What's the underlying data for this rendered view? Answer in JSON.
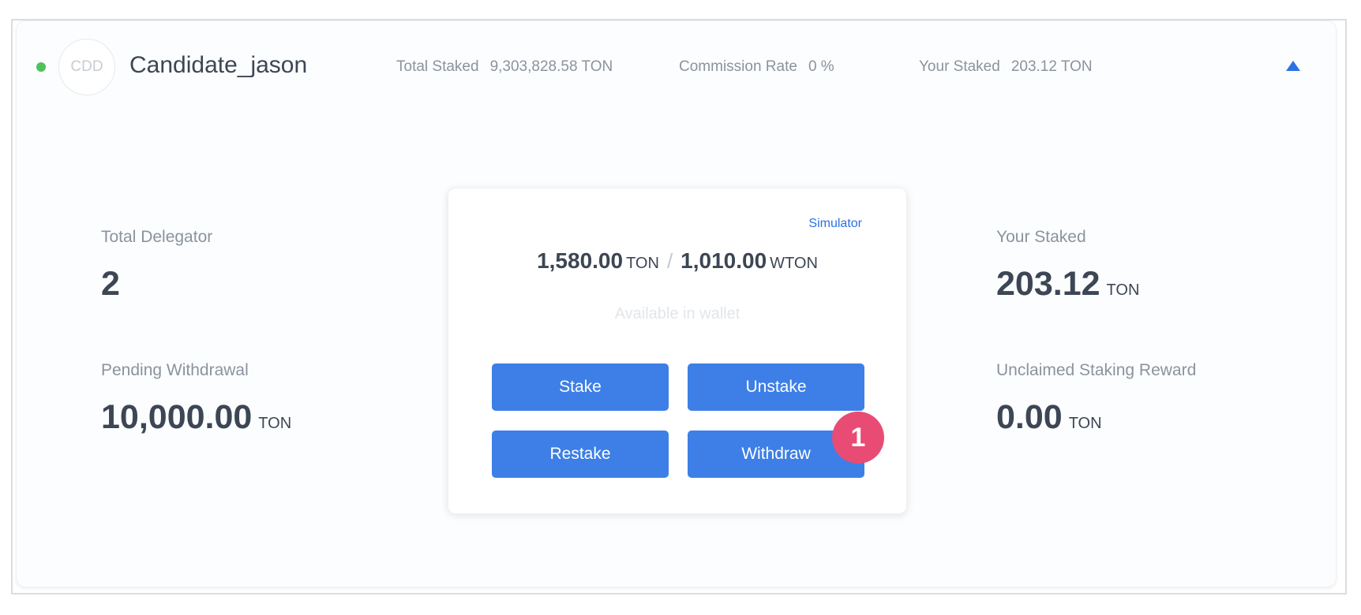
{
  "candidate": {
    "avatar_text": "CDD",
    "name": "Candidate_jason",
    "status_color": "#4fc25b"
  },
  "header_stats": {
    "total_staked_label": "Total Staked",
    "total_staked_value": "9,303,828.58 TON",
    "commission_rate_label": "Commission Rate",
    "commission_rate_value": "0 %",
    "your_staked_label": "Your Staked",
    "your_staked_value": "203.12 TON"
  },
  "metrics": {
    "total_delegator_label": "Total Delegator",
    "total_delegator_value": "2",
    "pending_withdrawal_label": "Pending Withdrawal",
    "pending_withdrawal_value": "10,000.00",
    "pending_withdrawal_unit": "TON",
    "your_staked_label": "Your Staked",
    "your_staked_value": "203.12",
    "your_staked_unit": "TON",
    "unclaimed_reward_label": "Unclaimed Staking Reward",
    "unclaimed_reward_value": "0.00",
    "unclaimed_reward_unit": "TON"
  },
  "panel": {
    "simulator_label": "Simulator",
    "ton_balance": "1,580.00",
    "ton_unit": "TON",
    "separator": "/",
    "wton_balance": "1,010.00",
    "wton_unit": "WTON",
    "available_label": "Available in wallet",
    "buttons": {
      "stake": "Stake",
      "unstake": "Unstake",
      "restake": "Restake",
      "withdraw": "Withdraw"
    }
  },
  "annotation": {
    "step_number": "1"
  },
  "colors": {
    "accent": "#3d7fe6",
    "badge": "#e84c74",
    "text_dark": "#3c4654",
    "text_muted": "#8a939e"
  },
  "icons": {
    "collapse": "triangle-up-icon"
  }
}
